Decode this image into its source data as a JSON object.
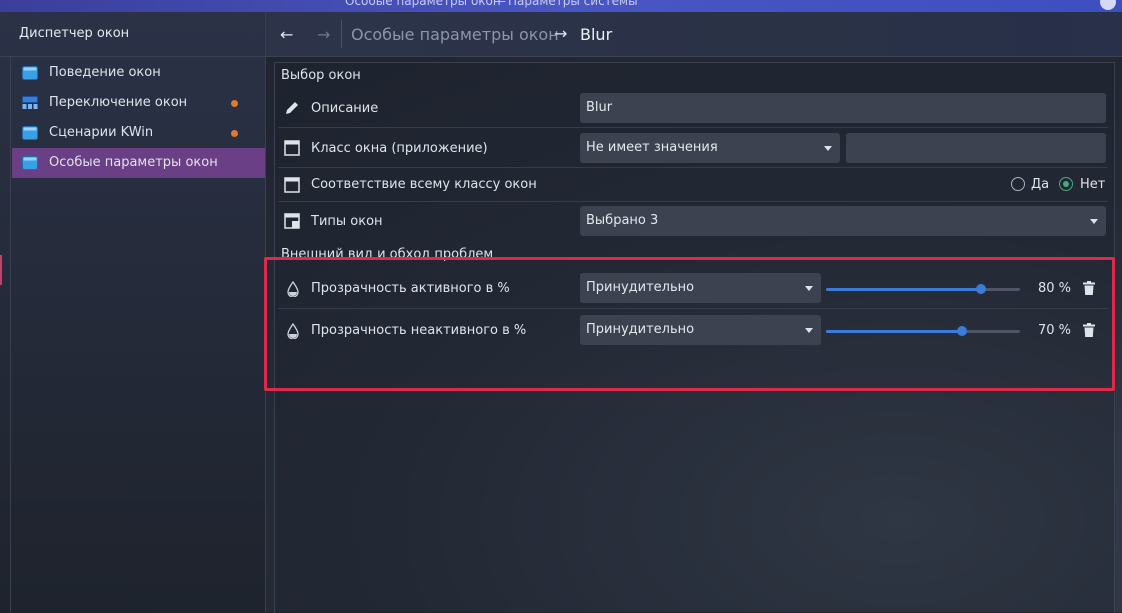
{
  "window": {
    "title_left": "Особые параметры окон",
    "title_sep": "—",
    "title_right": "Параметры системы"
  },
  "sidebar": {
    "header": "Диспетчер окон",
    "items": [
      {
        "label": "Поведение окон",
        "icon": "window-behavior-icon",
        "dot": false
      },
      {
        "label": "Переключение окон",
        "icon": "task-switcher-icon",
        "dot": true
      },
      {
        "label": "Сценарии KWin",
        "icon": "kwin-scripts-icon",
        "dot": true
      },
      {
        "label": "Особые параметры окон",
        "icon": "window-rules-icon",
        "dot": false,
        "active": true
      }
    ]
  },
  "header": {
    "back": "←",
    "forward": "→",
    "crumb_parent": "Особые параметры окон",
    "crumb_arrow": "→",
    "crumb_current": "Blur"
  },
  "selection": {
    "title": "Выбор окон",
    "description_label": "Описание",
    "description_value": "Blur",
    "class_label": "Класс окна (приложение)",
    "class_combo": "Не имеет значения",
    "class_value": "",
    "match_whole_label": "Соответствие всему классу окон",
    "yes": "Да",
    "no": "Нет",
    "match_whole_selected": "no",
    "types_label": "Типы окон",
    "types_value": "Выбрано 3"
  },
  "appearance": {
    "title": "Внешний вид и обход проблем",
    "rows": [
      {
        "label": "Прозрачность активного в %",
        "policy": "Принудительно",
        "value": 80,
        "value_text": "80 %"
      },
      {
        "label": "Прозрачность неактивного в %",
        "policy": "Принудительно",
        "value": 70,
        "value_text": "70 %"
      }
    ]
  },
  "colors": {
    "accent": "#3d7bd9",
    "active_item": "#6b3f86",
    "highlight": "#e02848",
    "notify_dot": "#e07b2d"
  }
}
